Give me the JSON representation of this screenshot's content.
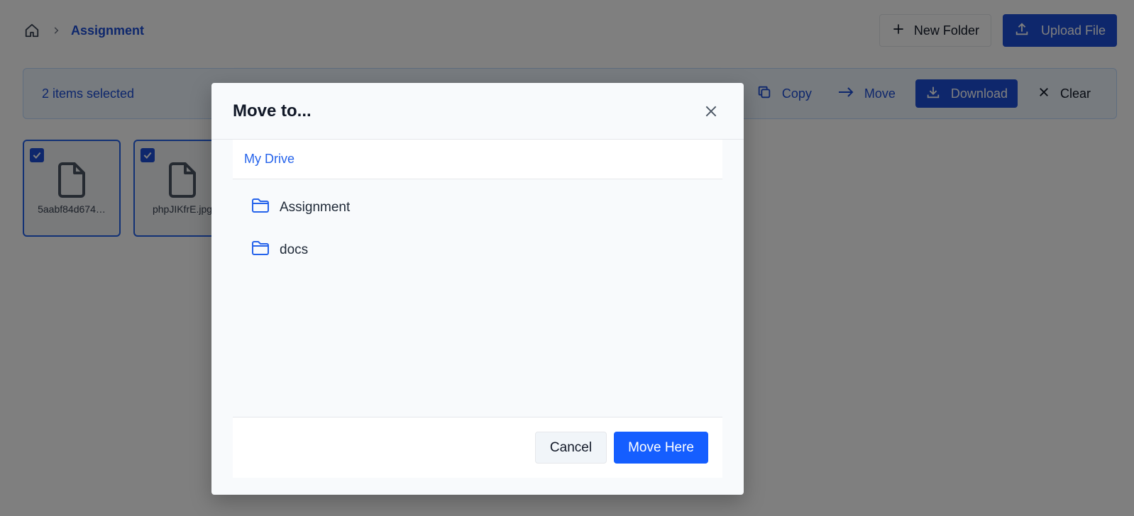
{
  "header": {
    "breadcrumb_current": "Assignment",
    "new_folder_label": "New Folder",
    "upload_label": "Upload File"
  },
  "selection_bar": {
    "count_text": "2 items selected",
    "copy_label": "Copy",
    "move_label": "Move",
    "download_label": "Download",
    "clear_label": "Clear"
  },
  "files": [
    {
      "name": "5aabf84d674…",
      "checked": true
    },
    {
      "name": "phpJIKfrE.jpg",
      "checked": true
    }
  ],
  "modal": {
    "title": "Move to...",
    "breadcrumb": "My Drive",
    "folders": [
      {
        "name": "Assignment"
      },
      {
        "name": "docs"
      }
    ],
    "cancel_label": "Cancel",
    "confirm_label": "Move Here"
  },
  "colors": {
    "primary": "#1d4ed8",
    "accent": "#155eff",
    "overlay": "rgba(0,0,0,0.5)"
  },
  "icons": {
    "home": "home-icon",
    "chevron": "chevron-right-icon",
    "plus": "plus-icon",
    "upload": "upload-icon",
    "copy": "copy-icon",
    "move": "arrow-right-icon",
    "download": "download-icon",
    "clear": "x-icon",
    "file": "file-icon",
    "folder": "folder-icon",
    "close": "close-icon",
    "check": "check-icon"
  }
}
